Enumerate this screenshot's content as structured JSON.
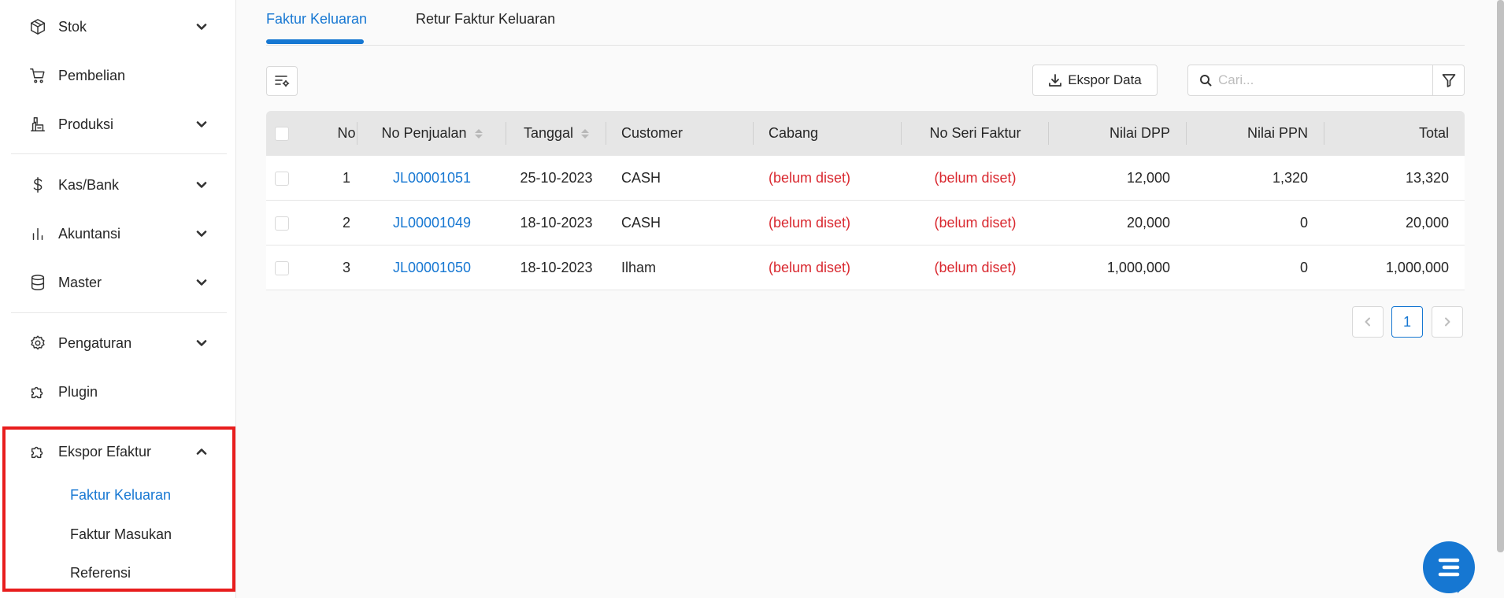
{
  "sidebar": {
    "items": [
      {
        "label": "Stok",
        "icon": "box-icon",
        "expandable": true
      },
      {
        "label": "Pembelian",
        "icon": "cart-icon",
        "expandable": false
      },
      {
        "label": "Produksi",
        "icon": "factory-icon",
        "expandable": true
      },
      {
        "label": "Kas/Bank",
        "icon": "dollar-icon",
        "expandable": true
      },
      {
        "label": "Akuntansi",
        "icon": "bar-chart-icon",
        "expandable": true
      },
      {
        "label": "Master",
        "icon": "database-icon",
        "expandable": true
      },
      {
        "label": "Pengaturan",
        "icon": "gear-icon",
        "expandable": true
      },
      {
        "label": "Plugin",
        "icon": "puzzle-icon",
        "expandable": false
      },
      {
        "label": "Ekspor Efaktur",
        "icon": "puzzle-icon",
        "expandable": true,
        "expanded": true
      }
    ],
    "submenu": [
      {
        "label": "Faktur Keluaran",
        "active": true
      },
      {
        "label": "Faktur Masukan",
        "active": false
      },
      {
        "label": "Referensi",
        "active": false
      }
    ],
    "highlight_color": "#e81d1d"
  },
  "tabs": [
    {
      "label": "Faktur Keluaran",
      "active": true
    },
    {
      "label": "Retur Faktur Keluaran",
      "active": false
    }
  ],
  "toolbar": {
    "export_label": "Ekspor Data",
    "search_placeholder": "Cari..."
  },
  "table": {
    "headers": [
      "No",
      "No Penjualan",
      "Tanggal",
      "Customer",
      "Cabang",
      "No Seri Faktur",
      "Nilai DPP",
      "Nilai PPN",
      "Total"
    ],
    "rows": [
      {
        "no": "1",
        "no_penjualan": "JL00001051",
        "tanggal": "25-10-2023",
        "customer": "CASH",
        "cabang": "(belum diset)",
        "no_seri_faktur": "(belum diset)",
        "nilai_dpp": "12,000",
        "nilai_ppn": "1,320",
        "total": "13,320"
      },
      {
        "no": "2",
        "no_penjualan": "JL00001049",
        "tanggal": "18-10-2023",
        "customer": "CASH",
        "cabang": "(belum diset)",
        "no_seri_faktur": "(belum diset)",
        "nilai_dpp": "20,000",
        "nilai_ppn": "0",
        "total": "20,000"
      },
      {
        "no": "3",
        "no_penjualan": "JL00001050",
        "tanggal": "18-10-2023",
        "customer": "Ilham",
        "cabang": "(belum diset)",
        "no_seri_faktur": "(belum diset)",
        "nilai_dpp": "1,000,000",
        "nilai_ppn": "0",
        "total": "1,000,000"
      }
    ]
  },
  "pagination": {
    "current_page": "1"
  },
  "colors": {
    "accent": "#1677d2",
    "warning_text": "#d9282f"
  }
}
